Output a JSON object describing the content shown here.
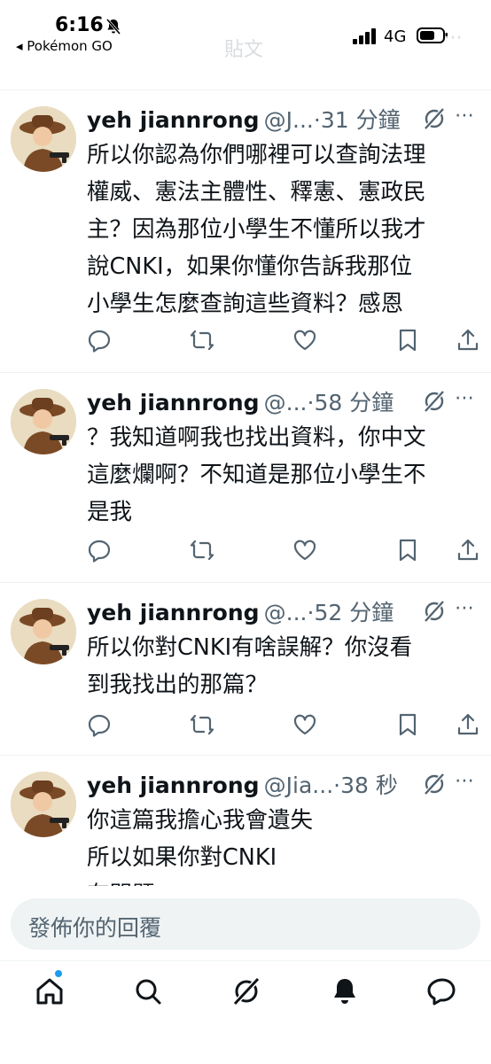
{
  "status_bar": {
    "time": "6:16",
    "back_app": "◂ Pokémon GO",
    "network": "4G",
    "faint_title": "貼文"
  },
  "tweets": [
    {
      "name": "yeh jiannrong",
      "handle": "@J...",
      "time": "·31 分鐘",
      "text": "所以你認為你們哪裡可以查詢法理\n權威、憲法主體性、釋憲、憲政民\n主？因為那位小學生不懂所以我才\n說CNKI，如果你懂你告訴我那位\n小學生怎麼查詢這些資料？感恩"
    },
    {
      "name": "yeh jiannrong",
      "handle": "@...",
      "time": "·58 分鐘",
      "text": "？我知道啊我也找出資料，你中文\n這麼爛啊？不知道是那位小學生不\n是我"
    },
    {
      "name": "yeh jiannrong",
      "handle": "@...",
      "time": "·52 分鐘",
      "text": "所以你對CNKI有啥誤解？你沒看\n到我找出的那篇？"
    },
    {
      "name": "yeh jiannrong",
      "handle": "@Jia...",
      "time": "·38 秒",
      "text": "你這篇我擔心我會遺失\n所以如果你對CNKI\n有問題"
    }
  ],
  "reply": {
    "placeholder": "發佈你的回覆"
  },
  "icons": {
    "reply": "reply-icon",
    "retweet": "retweet-icon",
    "like": "like-icon",
    "bookmark": "bookmark-icon",
    "share": "share-icon",
    "grok": "grok-icon",
    "more": "more-icon",
    "nav": [
      "home-icon",
      "search-icon",
      "grok-icon",
      "notifications-icon",
      "messages-icon"
    ]
  },
  "colors": {
    "text": "#0f1419",
    "secondary": "#536471",
    "accent": "#1d9bf0",
    "divider": "#eff3f4"
  }
}
